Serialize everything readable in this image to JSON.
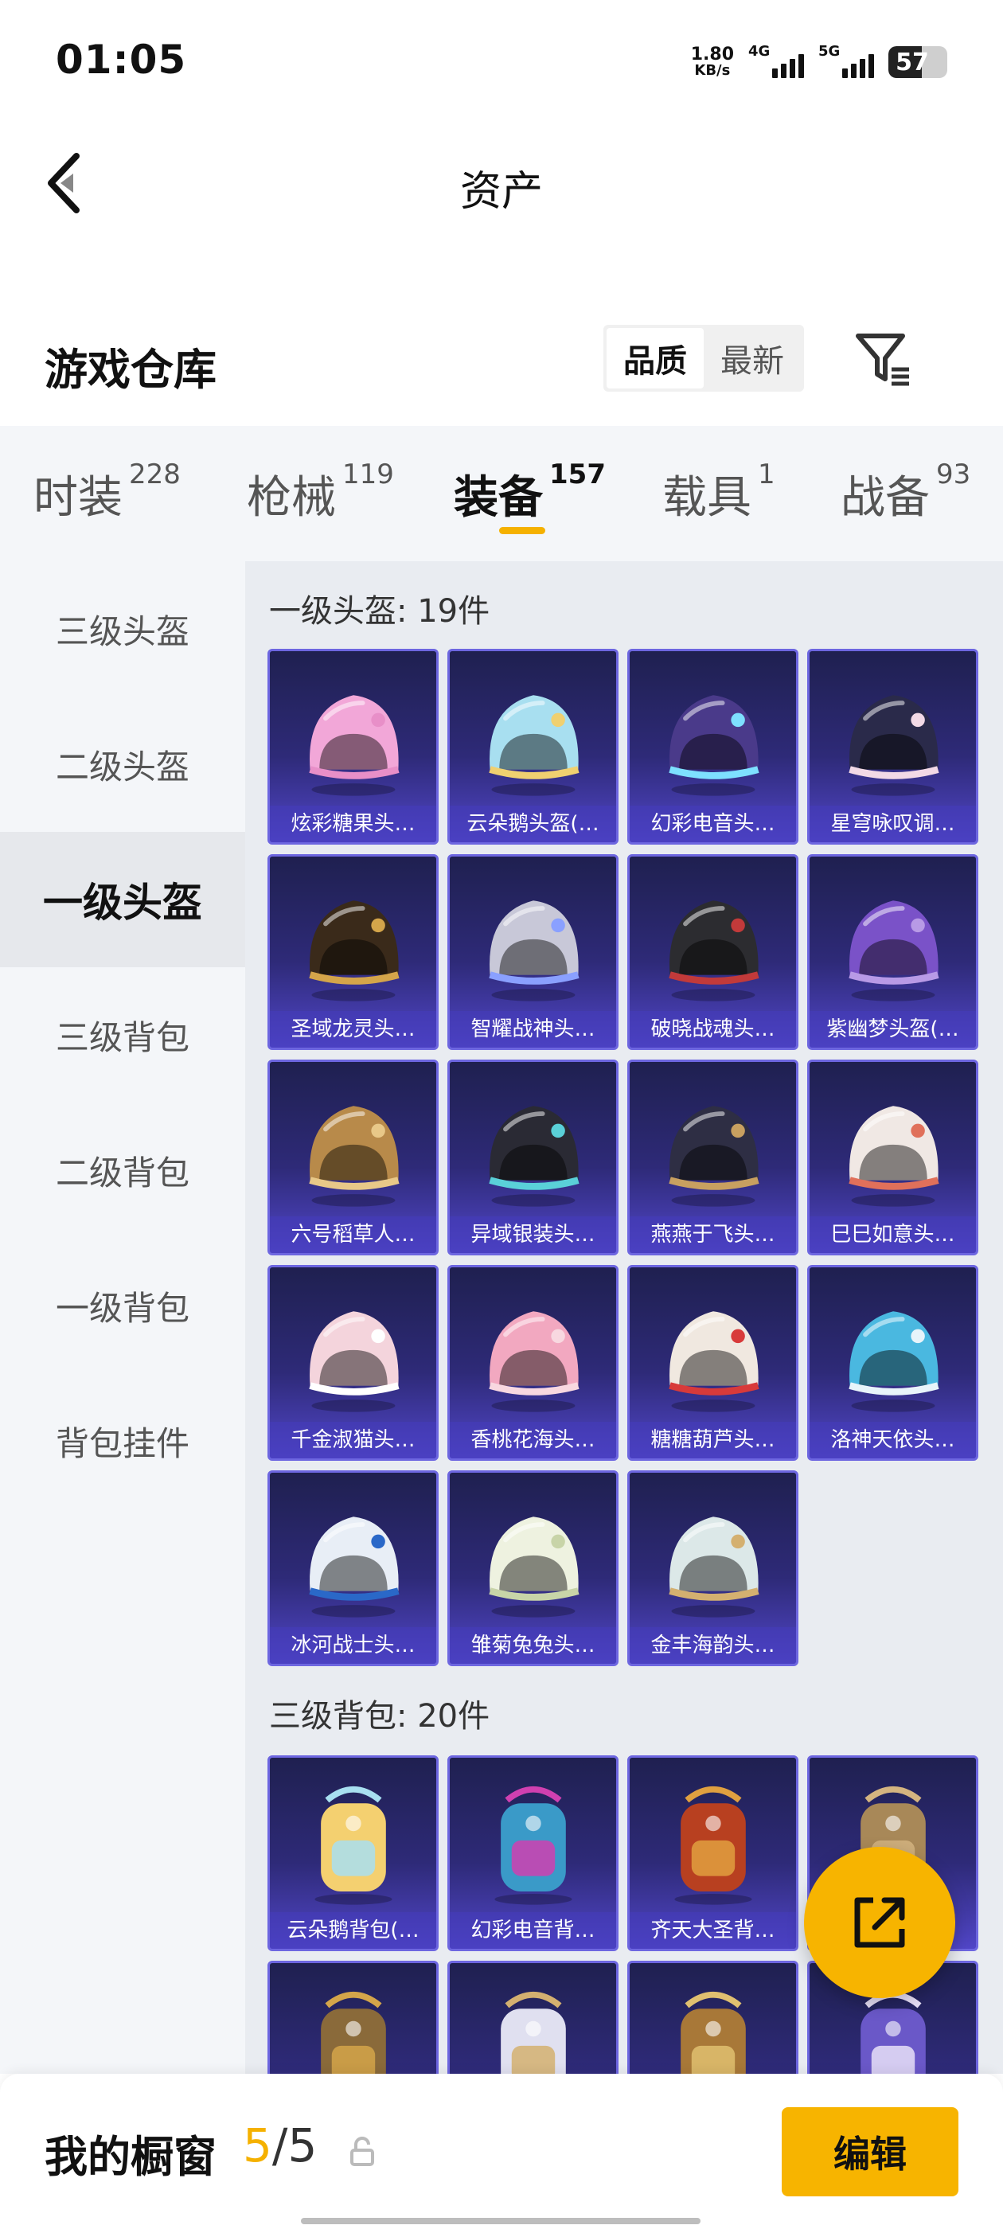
{
  "status_bar": {
    "time": "01:05",
    "net_speed_value": "1.80",
    "net_speed_unit": "KB/s",
    "sim1": "4G",
    "sim2": "5G",
    "battery": "57"
  },
  "header": {
    "title": "资产",
    "back_icon": "chevron-left-icon"
  },
  "warehouse": {
    "title": "游戏仓库",
    "sort_options": [
      "品质",
      "最新"
    ],
    "selected_sort": "品质",
    "filter_icon": "filter-icon"
  },
  "categories": [
    {
      "name": "时装",
      "count": "228"
    },
    {
      "name": "枪械",
      "count": "119"
    },
    {
      "name": "装备",
      "count": "157"
    },
    {
      "name": "载具",
      "count": "1"
    },
    {
      "name": "战备",
      "count": "93"
    }
  ],
  "active_category": "装备",
  "sidebar": {
    "items": [
      "三级头盔",
      "二级头盔",
      "一级头盔",
      "三级背包",
      "二级背包",
      "一级背包",
      "背包挂件"
    ],
    "active": "一级头盔"
  },
  "sections": [
    {
      "title": "一级头盔: 19件",
      "items": [
        {
          "label": "炫彩糖果头…",
          "color": "#f2a7d8",
          "trim": "#e88fc8"
        },
        {
          "label": "云朵鹅头盔(…",
          "color": "#a8dff0",
          "trim": "#f0d070"
        },
        {
          "label": "幻彩电音头…",
          "color": "#4a3a8a",
          "trim": "#7ee0ff"
        },
        {
          "label": "星穹咏叹调…",
          "color": "#2a2a4a",
          "trim": "#f2d9e6"
        },
        {
          "label": "圣域龙灵头…",
          "color": "#3a2a1a",
          "trim": "#d4a54a"
        },
        {
          "label": "智耀战神头…",
          "color": "#c8c8d8",
          "trim": "#8aa0ff"
        },
        {
          "label": "破晓战魂头…",
          "color": "#2c2c30",
          "trim": "#c23a3a"
        },
        {
          "label": "紫幽梦头盔(…",
          "color": "#7a52c8",
          "trim": "#b89ae6"
        },
        {
          "label": "六号稻草人…",
          "color": "#b88a4a",
          "trim": "#e8c888"
        },
        {
          "label": "异域银装头…",
          "color": "#2a2a34",
          "trim": "#5ad0d8"
        },
        {
          "label": "燕燕于飞头…",
          "color": "#2e2e44",
          "trim": "#c8a060"
        },
        {
          "label": "巳巳如意头…",
          "color": "#f0e8e4",
          "trim": "#e0705a"
        },
        {
          "label": "千金淑猫头…",
          "color": "#f4d4dc",
          "trim": "#ffffff"
        },
        {
          "label": "香桃花海头…",
          "color": "#f2a8c0",
          "trim": "#f8d8e0"
        },
        {
          "label": "糖糖葫芦头…",
          "color": "#f0e8e0",
          "trim": "#d83a3a"
        },
        {
          "label": "洛神天依头…",
          "color": "#4ab8e0",
          "trim": "#e8f4fa"
        },
        {
          "label": "冰河战士头…",
          "color": "#e8eef6",
          "trim": "#2a68c8"
        },
        {
          "label": "雏菊兔兔头…",
          "color": "#eef2e0",
          "trim": "#c8d4a8"
        },
        {
          "label": "金丰海韵头…",
          "color": "#dce8e8",
          "trim": "#d4b070"
        }
      ]
    },
    {
      "title": "三级背包: 20件",
      "items": [
        {
          "label": "云朵鹅背包(…",
          "color": "#f4d070",
          "trim": "#a8dff0"
        },
        {
          "label": "幻彩电音背…",
          "color": "#3a9ac8",
          "trim": "#d040b0"
        },
        {
          "label": "齐天大圣背…",
          "color": "#b84020",
          "trim": "#e0a040"
        },
        {
          "label": "",
          "color": "#a88858",
          "trim": "#d4b480"
        },
        {
          "label": "",
          "color": "#8a6a3a",
          "trim": "#d4a54a"
        },
        {
          "label": "",
          "color": "#e0e0f0",
          "trim": "#d4b070"
        },
        {
          "label": "",
          "color": "#a87838",
          "trim": "#e0c070"
        },
        {
          "label": "",
          "color": "#6a58c8",
          "trim": "#e8e0f8"
        }
      ]
    }
  ],
  "bottom_bar": {
    "title": "我的橱窗",
    "current": "5",
    "separator": "/",
    "total": "5",
    "edit_label": "编辑"
  },
  "share_icon": "share-icon"
}
